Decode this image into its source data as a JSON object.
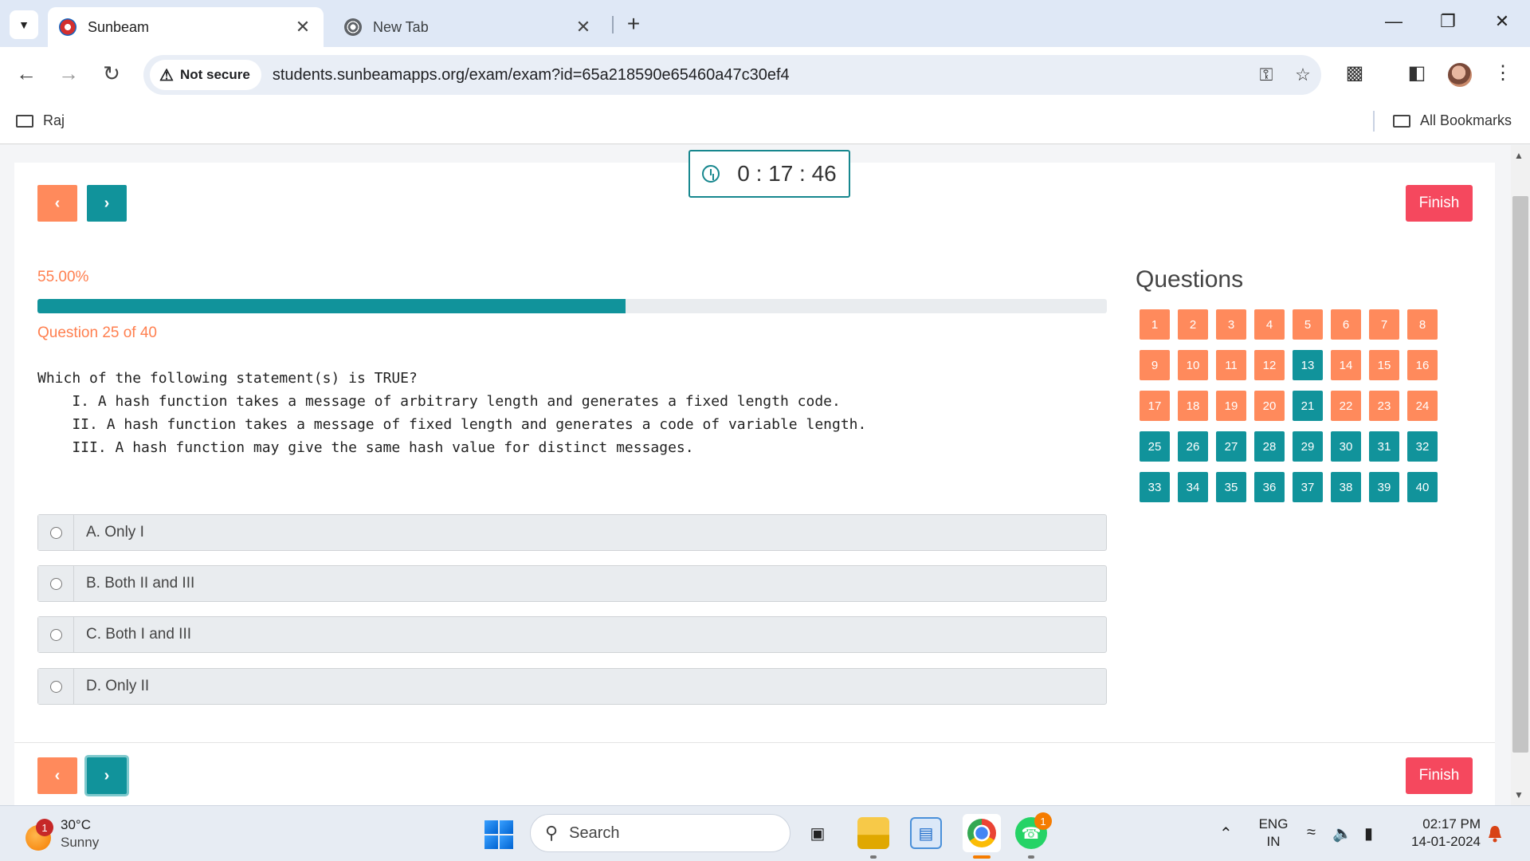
{
  "browser": {
    "tabs": [
      {
        "title": "Sunbeam",
        "active": true
      },
      {
        "title": "New Tab",
        "active": false
      }
    ],
    "new_tab_symbol": "+",
    "security_label": "Not secure",
    "url": "students.sunbeamapps.org/exam/exam?id=65a218590e65460a47c30ef4",
    "bookmarks": {
      "left": "Raj",
      "right": "All Bookmarks"
    }
  },
  "exam": {
    "timer": "0 : 17 : 46",
    "prev_label": "‹",
    "next_label": "›",
    "finish_label": "Finish",
    "progress_text": "55.00%",
    "progress_fraction": 0.55,
    "question_counter": "Question 25 of 40",
    "question_lines": [
      "Which of the following statement(s) is TRUE?",
      "    I. A hash function takes a message of arbitrary length and generates a fixed length code.",
      "    II. A hash function takes a message of fixed length and generates a code of variable length.",
      "    III. A hash function may give the same hash value for distinct messages."
    ],
    "options": [
      "A. Only I",
      "B. Both II and III",
      "C. Both I and III",
      "D. Only II"
    ],
    "questions_title": "Questions",
    "question_buttons": [
      {
        "n": "1",
        "state": "un"
      },
      {
        "n": "2",
        "state": "un"
      },
      {
        "n": "3",
        "state": "un"
      },
      {
        "n": "4",
        "state": "un"
      },
      {
        "n": "5",
        "state": "un"
      },
      {
        "n": "6",
        "state": "un"
      },
      {
        "n": "7",
        "state": "un"
      },
      {
        "n": "8",
        "state": "un"
      },
      {
        "n": "9",
        "state": "un"
      },
      {
        "n": "10",
        "state": "un"
      },
      {
        "n": "11",
        "state": "un"
      },
      {
        "n": "12",
        "state": "un"
      },
      {
        "n": "13",
        "state": "ans"
      },
      {
        "n": "14",
        "state": "un"
      },
      {
        "n": "15",
        "state": "un"
      },
      {
        "n": "16",
        "state": "un"
      },
      {
        "n": "17",
        "state": "un"
      },
      {
        "n": "18",
        "state": "un"
      },
      {
        "n": "19",
        "state": "un"
      },
      {
        "n": "20",
        "state": "un"
      },
      {
        "n": "21",
        "state": "ans"
      },
      {
        "n": "22",
        "state": "un"
      },
      {
        "n": "23",
        "state": "un"
      },
      {
        "n": "24",
        "state": "un"
      },
      {
        "n": "25",
        "state": "ans"
      },
      {
        "n": "26",
        "state": "ans"
      },
      {
        "n": "27",
        "state": "ans"
      },
      {
        "n": "28",
        "state": "ans"
      },
      {
        "n": "29",
        "state": "ans"
      },
      {
        "n": "30",
        "state": "ans"
      },
      {
        "n": "31",
        "state": "ans"
      },
      {
        "n": "32",
        "state": "ans"
      },
      {
        "n": "33",
        "state": "ans"
      },
      {
        "n": "34",
        "state": "ans"
      },
      {
        "n": "35",
        "state": "ans"
      },
      {
        "n": "36",
        "state": "ans"
      },
      {
        "n": "37",
        "state": "ans"
      },
      {
        "n": "38",
        "state": "ans"
      },
      {
        "n": "39",
        "state": "ans"
      },
      {
        "n": "40",
        "state": "ans"
      }
    ],
    "colors": {
      "accent": "#11939b",
      "unanswered": "#ff8a5c",
      "finish": "#f5485e",
      "text_orange": "#ff7f4f"
    }
  },
  "taskbar": {
    "weather_temp": "30°C",
    "weather_desc": "Sunny",
    "weather_badge": "1",
    "search_placeholder": "Search",
    "whatsapp_badge": "1",
    "lang_top": "ENG",
    "lang_bottom": "IN",
    "time": "02:17 PM",
    "date": "14-01-2024"
  }
}
